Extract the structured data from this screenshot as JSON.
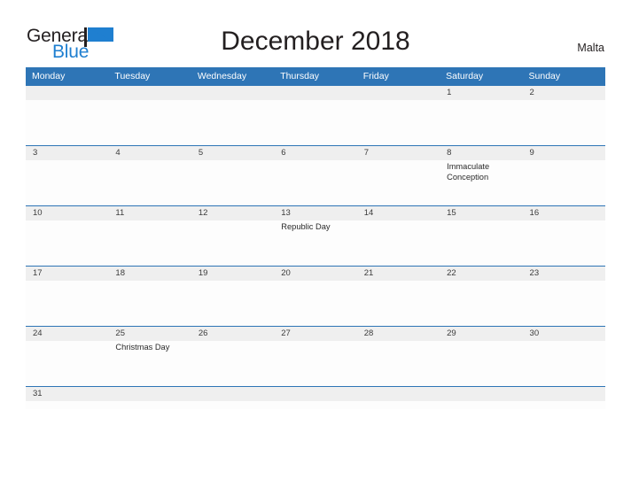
{
  "brand": {
    "word_one": "General",
    "word_two": "Blue",
    "flag_icon": "blue-flag-icon",
    "color_dark": "#231f20",
    "color_blue": "#1f7fd0"
  },
  "header": {
    "title": "December 2018",
    "region": "Malta"
  },
  "theme": {
    "header_blue": "#2e75b6",
    "band_gray": "#efefef",
    "text_dark": "#231f20"
  },
  "calendar": {
    "day_headers": [
      "Monday",
      "Tuesday",
      "Wednesday",
      "Thursday",
      "Friday",
      "Saturday",
      "Sunday"
    ],
    "weeks": [
      {
        "size": "tall",
        "days": [
          {
            "num": "",
            "event": ""
          },
          {
            "num": "",
            "event": ""
          },
          {
            "num": "",
            "event": ""
          },
          {
            "num": "",
            "event": ""
          },
          {
            "num": "",
            "event": ""
          },
          {
            "num": "1",
            "event": ""
          },
          {
            "num": "2",
            "event": ""
          }
        ]
      },
      {
        "size": "tall",
        "days": [
          {
            "num": "3",
            "event": ""
          },
          {
            "num": "4",
            "event": ""
          },
          {
            "num": "5",
            "event": ""
          },
          {
            "num": "6",
            "event": ""
          },
          {
            "num": "7",
            "event": ""
          },
          {
            "num": "8",
            "event": "Immaculate Conception"
          },
          {
            "num": "9",
            "event": ""
          }
        ]
      },
      {
        "size": "tall",
        "days": [
          {
            "num": "10",
            "event": ""
          },
          {
            "num": "11",
            "event": ""
          },
          {
            "num": "12",
            "event": ""
          },
          {
            "num": "13",
            "event": "Republic Day"
          },
          {
            "num": "14",
            "event": ""
          },
          {
            "num": "15",
            "event": ""
          },
          {
            "num": "16",
            "event": ""
          }
        ]
      },
      {
        "size": "tall",
        "days": [
          {
            "num": "17",
            "event": ""
          },
          {
            "num": "18",
            "event": ""
          },
          {
            "num": "19",
            "event": ""
          },
          {
            "num": "20",
            "event": ""
          },
          {
            "num": "21",
            "event": ""
          },
          {
            "num": "22",
            "event": ""
          },
          {
            "num": "23",
            "event": ""
          }
        ]
      },
      {
        "size": "tall",
        "days": [
          {
            "num": "24",
            "event": ""
          },
          {
            "num": "25",
            "event": "Christmas Day"
          },
          {
            "num": "26",
            "event": ""
          },
          {
            "num": "27",
            "event": ""
          },
          {
            "num": "28",
            "event": ""
          },
          {
            "num": "29",
            "event": ""
          },
          {
            "num": "30",
            "event": ""
          }
        ]
      },
      {
        "size": "short",
        "days": [
          {
            "num": "31",
            "event": ""
          },
          {
            "num": "",
            "event": ""
          },
          {
            "num": "",
            "event": ""
          },
          {
            "num": "",
            "event": ""
          },
          {
            "num": "",
            "event": ""
          },
          {
            "num": "",
            "event": ""
          },
          {
            "num": "",
            "event": ""
          }
        ]
      }
    ]
  }
}
